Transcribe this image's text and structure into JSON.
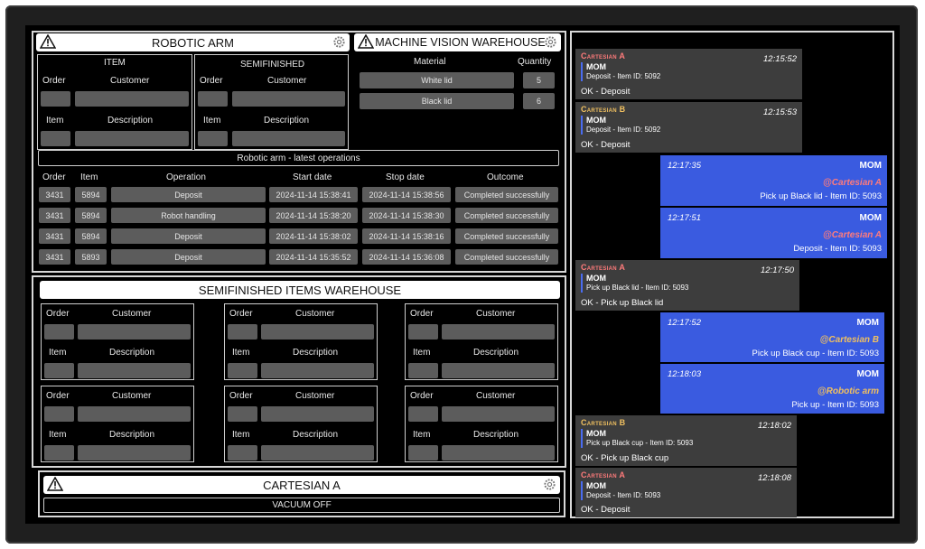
{
  "robotic_arm": {
    "title": "ROBOTIC ARM",
    "item_section": {
      "header": "ITEM",
      "order_label": "Order",
      "customer_label": "Customer",
      "item_label": "Item",
      "description_label": "Description"
    },
    "semi_section": {
      "header": "SEMIFINISHED",
      "order_label": "Order",
      "customer_label": "Customer",
      "item_label": "Item",
      "description_label": "Description"
    },
    "latest_ops_title": "Robotic arm - latest operations",
    "ops_columns": [
      "Order",
      "Item",
      "Operation",
      "Start date",
      "Stop date",
      "Outcome"
    ],
    "ops_rows": [
      {
        "order": "3431",
        "item": "5894",
        "operation": "Deposit",
        "start": "2024-11-14 15:38:41",
        "stop": "2024-11-14 15:38:56",
        "outcome": "Completed successfully"
      },
      {
        "order": "3431",
        "item": "5894",
        "operation": "Robot handling",
        "start": "2024-11-14 15:38:20",
        "stop": "2024-11-14 15:38:30",
        "outcome": "Completed successfully"
      },
      {
        "order": "3431",
        "item": "5894",
        "operation": "Deposit",
        "start": "2024-11-14 15:38:02",
        "stop": "2024-11-14 15:38:16",
        "outcome": "Completed successfully"
      },
      {
        "order": "3431",
        "item": "5893",
        "operation": "Deposit",
        "start": "2024-11-14 15:35:52",
        "stop": "2024-11-14 15:36:08",
        "outcome": "Completed successfully"
      }
    ]
  },
  "vision": {
    "title": "MACHINE VISION WAREHOUSE",
    "material_label": "Material",
    "quantity_label": "Quantity",
    "rows": [
      {
        "material": "White lid",
        "quantity": "5"
      },
      {
        "material": "Black lid",
        "quantity": "6"
      }
    ]
  },
  "semi_warehouse": {
    "title": "SEMIFINISHED ITEMS WAREHOUSE",
    "order_label": "Order",
    "customer_label": "Customer",
    "item_label": "Item",
    "description_label": "Description"
  },
  "cartesian_a": {
    "title": "CARTESIAN A",
    "status": "VACUUM OFF"
  },
  "chat": {
    "colors": {
      "cartesian_a": "#ff7b7b",
      "cartesian_b": "#f0c060",
      "bubble_in": "#3d3d3d",
      "bubble_out": "#3a5be0"
    },
    "messages": [
      {
        "sender": "Cartesian A",
        "time": "12:15:52",
        "quote_title": "MOM",
        "quote_text": "Deposit - Item ID: 5092",
        "text": "OK - Deposit"
      },
      {
        "sender": "Cartesian B",
        "time": "12:15:53",
        "quote_title": "MOM",
        "quote_text": "Deposit - Item ID: 5092",
        "text": "OK - Deposit"
      },
      {
        "sender": "MOM",
        "time": "12:17:35",
        "mention": "@Cartesian A",
        "text": "Pick up Black lid - Item ID: 5093"
      },
      {
        "sender": "MOM",
        "time": "12:17:51",
        "mention": "@Cartesian A",
        "text": "Deposit - Item ID: 5093"
      },
      {
        "sender": "Cartesian A",
        "time": "12:17:50",
        "quote_title": "MOM",
        "quote_text": "Pick up Black lid - Item ID: 5093",
        "text": "OK - Pick up Black lid"
      },
      {
        "sender": "MOM",
        "time": "12:17:52",
        "mention": "@Cartesian B",
        "text": "Pick up Black cup - Item ID: 5093"
      },
      {
        "sender": "MOM",
        "time": "12:18:03",
        "mention": "@Robotic arm",
        "text": "Pick up - Item ID: 5093"
      },
      {
        "sender": "Cartesian B",
        "time": "12:18:02",
        "quote_title": "MOM",
        "quote_text": "Pick up Black cup - Item ID: 5093",
        "text": "OK - Pick up Black cup"
      },
      {
        "sender": "Cartesian A",
        "time": "12:18:08",
        "quote_title": "MOM",
        "quote_text": "Deposit - Item ID: 5093",
        "text": "OK - Deposit"
      }
    ]
  }
}
